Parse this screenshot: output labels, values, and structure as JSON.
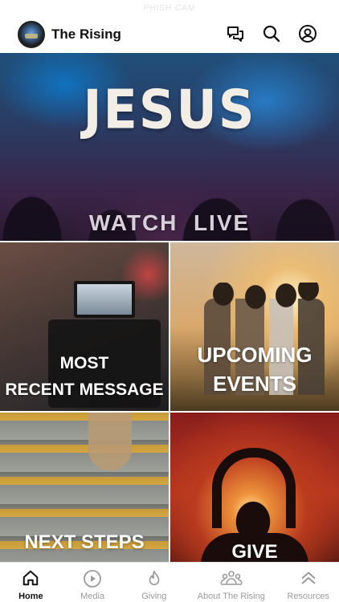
{
  "status_bar": {
    "text": "PHISH CAM"
  },
  "header": {
    "title": "The Rising",
    "icons": [
      "messages-icon",
      "search-icon",
      "account-icon"
    ]
  },
  "tiles": {
    "hero": {
      "overlay_text": "JESUS",
      "label": "WATCH  LIVE"
    },
    "message": {
      "label_line1": "MOST",
      "label_line2": "RECENT MESSAGE"
    },
    "events": {
      "label_line1": "UPCOMING",
      "label_line2": "EVENTS"
    },
    "steps": {
      "label": "NEXT STEPS"
    },
    "give": {
      "label": "GIVE"
    }
  },
  "tabbar": {
    "items": [
      {
        "label": "Home",
        "icon": "home-icon",
        "active": true
      },
      {
        "label": "Media",
        "icon": "play-icon",
        "active": false
      },
      {
        "label": "Giving",
        "icon": "flame-icon",
        "active": false
      },
      {
        "label": "About The Rising",
        "icon": "people-icon",
        "active": false
      },
      {
        "label": "Resources",
        "icon": "chevrons-up-icon",
        "active": false
      }
    ]
  },
  "colors": {
    "accent": "#111111",
    "inactive": "#9a9a9a",
    "background": "#ffffff"
  }
}
